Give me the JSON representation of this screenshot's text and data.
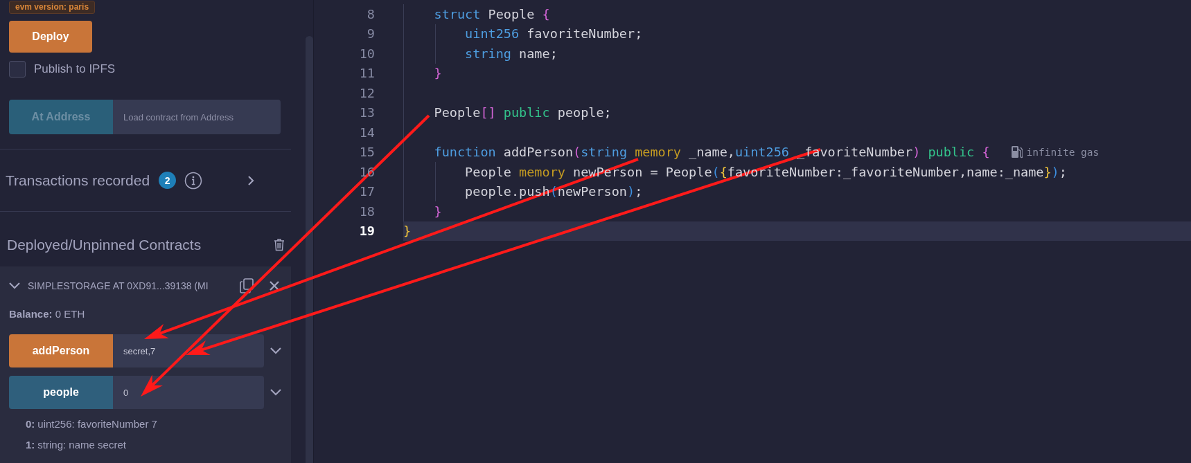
{
  "run_panel": {
    "evm_badge": "evm version: paris",
    "deploy_button": "Deploy",
    "publish": {
      "label": "Publish to IPFS",
      "checked": false
    },
    "at_address": {
      "button": "At Address",
      "placeholder": "Load contract from Address",
      "disabled": true
    },
    "transactions": {
      "label": "Transactions recorded",
      "count": "2"
    },
    "deployed_title": "Deployed/Unpinned Contracts",
    "contract": {
      "title": "SIMPLESTORAGE AT 0XD91...39138 (MI",
      "expanded": true,
      "balance_label": "Balance:",
      "balance": "0 ETH",
      "functions": [
        {
          "name": "addPerson",
          "kind": "transact",
          "value": "secret,7"
        },
        {
          "name": "people",
          "kind": "call",
          "value": "0"
        }
      ],
      "outputs": [
        {
          "index": "0:",
          "text": "uint256: favoriteNumber 7"
        },
        {
          "index": "1:",
          "text": "string: name secret"
        }
      ]
    }
  },
  "editor": {
    "lines": [
      {
        "number": "8",
        "current": false,
        "tokens": [
          {
            "text": "    struct",
            "kind": "keyword"
          },
          {
            "text": " People ",
            "kind": "plain"
          },
          {
            "text": "{",
            "kind": "pink"
          }
        ]
      },
      {
        "number": "9",
        "current": false,
        "tokens": [
          {
            "text": "        uint256",
            "kind": "keyword"
          },
          {
            "text": " favoriteNumber;",
            "kind": "plain"
          }
        ]
      },
      {
        "number": "10",
        "current": false,
        "tokens": [
          {
            "text": "        string",
            "kind": "keyword"
          },
          {
            "text": " name;",
            "kind": "plain"
          }
        ]
      },
      {
        "number": "11",
        "current": false,
        "tokens": [
          {
            "text": "    }",
            "kind": "pink"
          }
        ]
      },
      {
        "number": "12",
        "current": false
      },
      {
        "number": "13",
        "current": false,
        "tokens": [
          {
            "text": "    People",
            "kind": "plain"
          },
          {
            "text": "[]",
            "kind": "pink"
          },
          {
            "text": " public",
            "kind": "modifier"
          },
          {
            "text": " people;",
            "kind": "plain"
          }
        ]
      },
      {
        "number": "14",
        "current": false
      },
      {
        "number": "15",
        "current": false,
        "tokens": [
          {
            "text": "    function",
            "kind": "keyword"
          },
          {
            "text": " addPerson",
            "kind": "plain"
          },
          {
            "text": "(",
            "kind": "pink"
          },
          {
            "text": "string",
            "kind": "keyword"
          },
          {
            "text": " memory",
            "kind": "storage"
          },
          {
            "text": " _name,",
            "kind": "plain"
          },
          {
            "text": "uint256",
            "kind": "keyword"
          },
          {
            "text": " _favoriteNumber",
            "kind": "plain"
          },
          {
            "text": ")",
            "kind": "pink"
          },
          {
            "text": " public",
            "kind": "modifier"
          },
          {
            "text": " {",
            "kind": "pink"
          }
        ],
        "hint": "infinite gas"
      },
      {
        "number": "16",
        "current": false,
        "tokens": [
          {
            "text": "        People",
            "kind": "plain"
          },
          {
            "text": " memory",
            "kind": "storage"
          },
          {
            "text": " newPerson = People",
            "kind": "plain"
          },
          {
            "text": "(",
            "kind": "blue"
          },
          {
            "text": "{",
            "kind": "yellow"
          },
          {
            "text": "favoriteNumber:_favoriteNumber,name:_name",
            "kind": "plain"
          },
          {
            "text": "}",
            "kind": "yellow"
          },
          {
            "text": ")",
            "kind": "blue"
          },
          {
            "text": ";",
            "kind": "plain"
          }
        ]
      },
      {
        "number": "17",
        "current": false,
        "tokens": [
          {
            "text": "        people.push",
            "kind": "plain"
          },
          {
            "text": "(",
            "kind": "blue"
          },
          {
            "text": "newPerson",
            "kind": "plain"
          },
          {
            "text": ")",
            "kind": "blue"
          },
          {
            "text": ";",
            "kind": "plain"
          }
        ]
      },
      {
        "number": "18",
        "current": false,
        "tokens": [
          {
            "text": "    }",
            "kind": "pink"
          }
        ]
      },
      {
        "number": "19",
        "current": true,
        "tokens": [
          {
            "text": "}",
            "kind": "yellow"
          }
        ]
      }
    ]
  }
}
